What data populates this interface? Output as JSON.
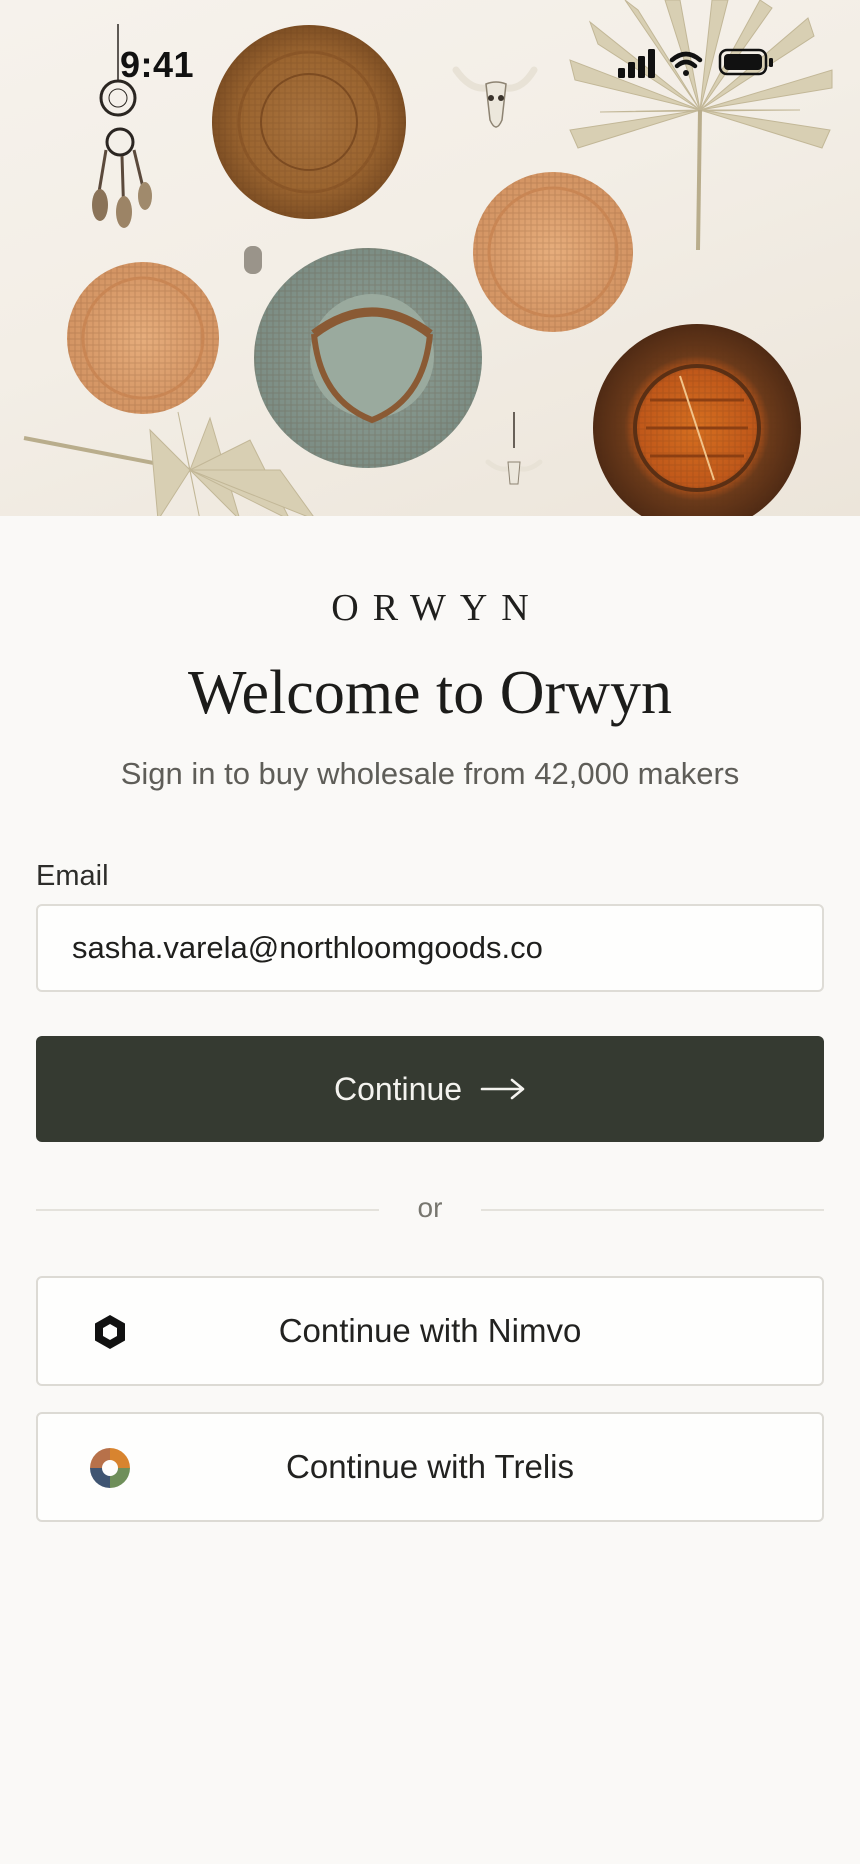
{
  "status_bar": {
    "time": "9:41",
    "icons": [
      "signal-icon",
      "wifi-icon",
      "battery-icon"
    ]
  },
  "hero": {
    "description_icon": "hero-photo"
  },
  "brand": {
    "logo": "ORWYN"
  },
  "header": {
    "title": "Welcome to Orwyn",
    "subtitle": "Sign in to buy wholesale from 42,000 makers"
  },
  "form": {
    "email_label": "Email",
    "email_value": "sasha.varela@northloomgoods.co",
    "continue_label": "Continue",
    "continue_icon": "arrow-right-icon"
  },
  "divider": {
    "label": "or"
  },
  "sso": [
    {
      "label": "Continue with Nimvo",
      "icon": "nimvo-logo-icon"
    },
    {
      "label": "Continue with Trelis",
      "icon": "trelis-logo-icon"
    }
  ],
  "colors": {
    "background": "#faf9f7",
    "primary_button": "#353a31",
    "primary_button_text": "#f4f3ef",
    "border": "#dcdad4",
    "muted_text": "#5e5d58"
  }
}
